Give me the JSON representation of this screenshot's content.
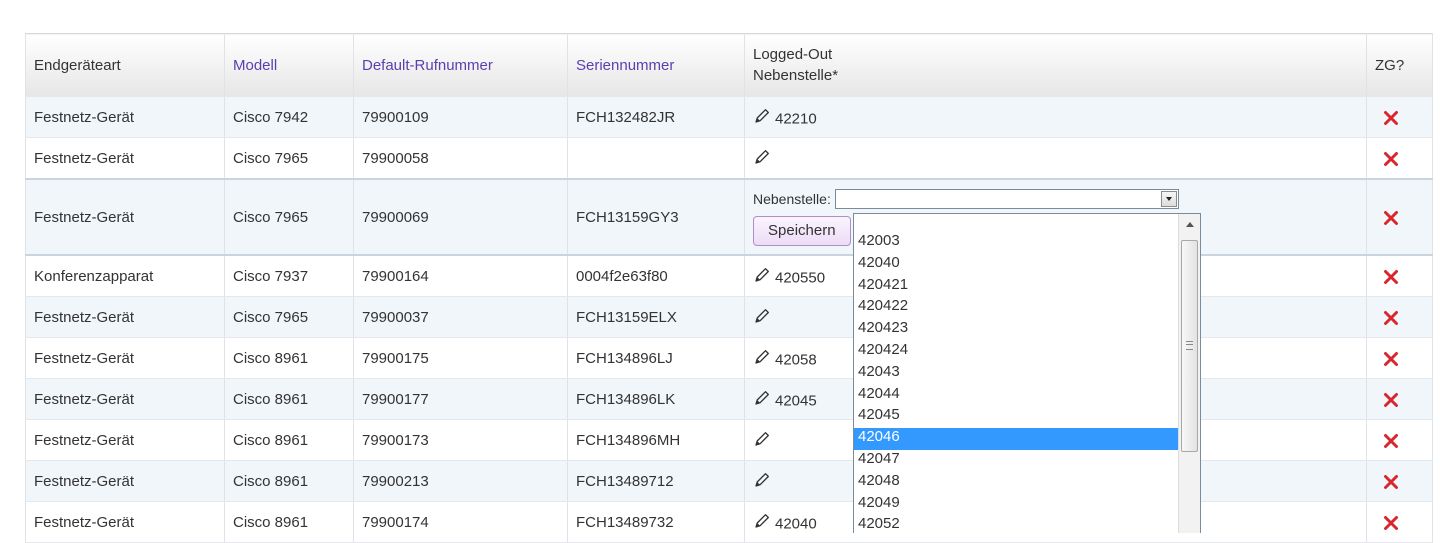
{
  "table": {
    "headers": {
      "type": "Endgeräteart",
      "model": "Modell",
      "default_number": "Default-Rufnummer",
      "serial": "Seriennummer",
      "logged_out_line1": "Logged-Out",
      "logged_out_line2": "Nebenstelle*",
      "zg": "ZG?"
    },
    "rows": [
      {
        "type": "Festnetz-Gerät",
        "model": "Cisco 7942",
        "number": "79900109",
        "serial": "FCH132482JR",
        "extension": "42210"
      },
      {
        "type": "Festnetz-Gerät",
        "model": "Cisco 7965",
        "number": "79900058",
        "serial": "",
        "extension": ""
      },
      {
        "type": "Festnetz-Gerät",
        "model": "Cisco 7965",
        "number": "79900069",
        "serial": "FCH13159GY3",
        "extension": ""
      },
      {
        "type": "Konferenzapparat",
        "model": "Cisco 7937",
        "number": "79900164",
        "serial": "0004f2e63f80",
        "extension": "420550"
      },
      {
        "type": "Festnetz-Gerät",
        "model": "Cisco 7965",
        "number": "79900037",
        "serial": "FCH13159ELX",
        "extension": ""
      },
      {
        "type": "Festnetz-Gerät",
        "model": "Cisco 8961",
        "number": "79900175",
        "serial": "FCH134896LJ",
        "extension": "42058"
      },
      {
        "type": "Festnetz-Gerät",
        "model": "Cisco 8961",
        "number": "79900177",
        "serial": "FCH134896LK",
        "extension": "42045"
      },
      {
        "type": "Festnetz-Gerät",
        "model": "Cisco 8961",
        "number": "79900173",
        "serial": "FCH134896MH",
        "extension": ""
      },
      {
        "type": "Festnetz-Gerät",
        "model": "Cisco 8961",
        "number": "79900213",
        "serial": "FCH13489712",
        "extension": ""
      },
      {
        "type": "Festnetz-Gerät",
        "model": "Cisco 8961",
        "number": "79900174",
        "serial": "FCH13489732",
        "extension": "42040"
      }
    ]
  },
  "edit_form": {
    "label": "Nebenstelle:",
    "select_value": "",
    "save_label": "Speichern"
  },
  "dropdown": {
    "options": [
      "42003",
      "42040",
      "420421",
      "420422",
      "420423",
      "420424",
      "42043",
      "42044",
      "42045",
      "42046",
      "42047",
      "42048",
      "42049",
      "42052"
    ],
    "selected": "42046"
  },
  "icons": {
    "edit": "pencil-icon",
    "delete": "delete-x-icon",
    "delete_color": "#d9262c",
    "selection_color": "#3399ff",
    "header_link_color": "#5a3fb0"
  }
}
